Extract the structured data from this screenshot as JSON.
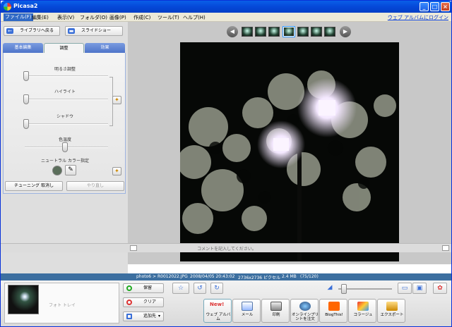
{
  "window": {
    "title": "Picasa2"
  },
  "menu": {
    "items": [
      "ファイル(F)",
      "編集(E)",
      "表示(V)",
      "フォルダ(O)",
      "画像(P)",
      "作成(C)",
      "ツール(T)",
      "ヘルプ(H)"
    ],
    "web_album_link": "ウェブ アルバムにログイン"
  },
  "left_toolbar": {
    "back_label": "ライブラリへ戻る",
    "slideshow_label": "スライドショー"
  },
  "tabs": [
    "基本編集",
    "調整",
    "効果"
  ],
  "active_tab": "調整",
  "tuning": {
    "brightness_label": "明るさ調整",
    "brightness_value": 0.0,
    "highlight_label": "ハイライト",
    "highlight_value": 0.0,
    "shadow_label": "シャドウ",
    "shadow_value": 0.0,
    "color_temp_label": "色温度",
    "color_temp_value": 0.5,
    "neutral_color_label": "ニュートラル カラー指定",
    "neutral_color": "#5b6e5b",
    "undo_label": "チューニング 取消し",
    "redo_label": "やり直し"
  },
  "caption": {
    "placeholder": "コメントを記入してください。"
  },
  "infobar": {
    "path": "photo6 > R0012022.JPG",
    "datetime": "2008/04/05 20:43:02",
    "dimensions": "2736x2736 ピクセル",
    "size": "2.4 MB",
    "position": "(75/120)"
  },
  "tray": {
    "label": "フォト トレイ",
    "hold_label": "保留",
    "clear_label": "クリア",
    "add_label": "追加先"
  },
  "actions": [
    {
      "name": "web-album",
      "label": "ウェブ アルバム",
      "badge": "New!"
    },
    {
      "name": "email",
      "label": "メール"
    },
    {
      "name": "print",
      "label": "印刷"
    },
    {
      "name": "order-prints",
      "label": "オンラインプリントを注文"
    },
    {
      "name": "blogthis",
      "label": "BlogThis!"
    },
    {
      "name": "collage",
      "label": "コラージュ"
    },
    {
      "name": "export",
      "label": "エクスポート"
    }
  ],
  "zoom_value": 0.05,
  "colors": {
    "accent": "#3a6fd8",
    "title_bar": "#0548d8",
    "info_bar": "#3c6fa0"
  }
}
